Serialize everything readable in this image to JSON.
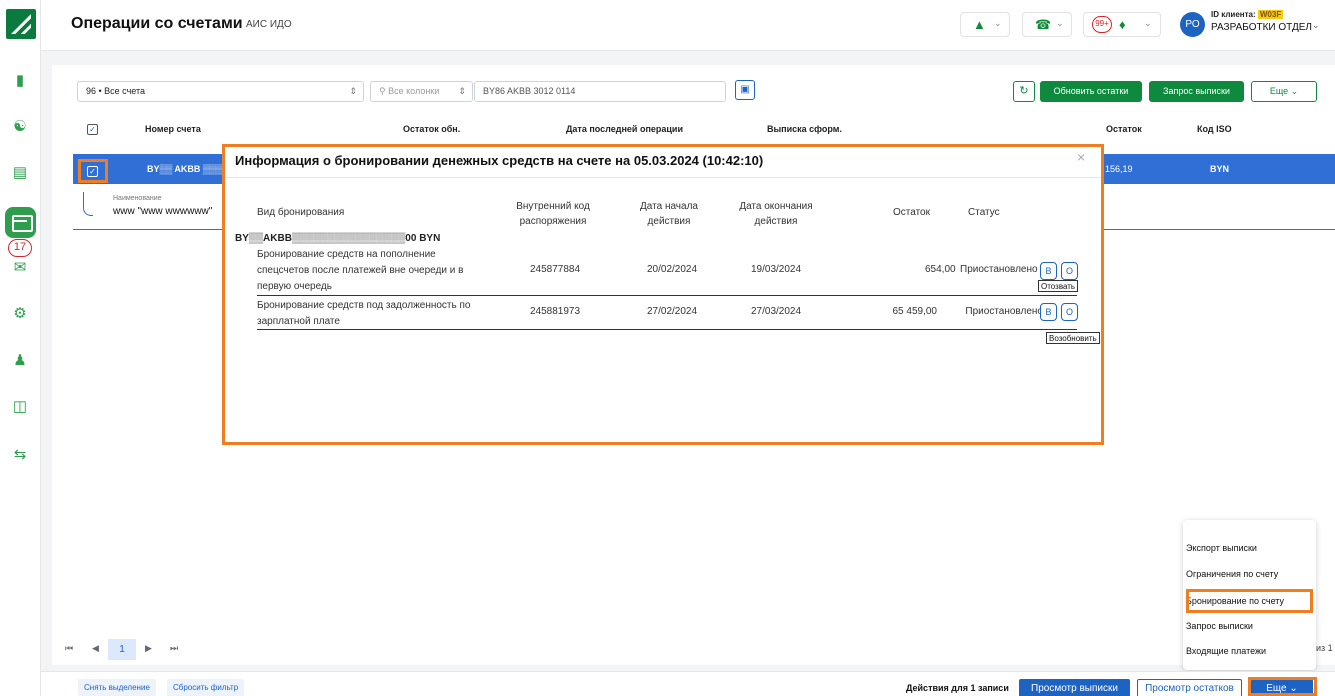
{
  "header": {
    "title": "Операции со счетами",
    "subtitle": "АИС ИДО",
    "notifications_count": "99+",
    "avatar_initials": "РО",
    "client_id_label": "ID клиента:",
    "client_id_value": "W03F",
    "client_name": "РАЗРАБОТКИ ОТДЕЛ"
  },
  "sidebar": {
    "badge_count": "17"
  },
  "toolbar": {
    "account_select": "96 • Все счета",
    "column_select_placeholder": "Все колонки",
    "search_value": "BY86 AKBB 3012 0114",
    "refresh_balances_label": "Обновить остатки",
    "request_statement_label": "Запрос выписки",
    "more_label": "Еще"
  },
  "table": {
    "headers": [
      "Номер счета",
      "Остаток обн.",
      "Дата последней операции",
      "Выписка сформ.",
      "Остаток",
      "Код ISO"
    ],
    "selected_row": {
      "account": "BY▒▒ AKBB ▒▒▒",
      "balance": "156,19",
      "iso": "BYN"
    },
    "sub_row": {
      "label": "Наименование",
      "value": "www \"www wwwwww\""
    }
  },
  "modal": {
    "title": "Информация о бронировании денежных средств на счете на 05.03.2024 (10:42:10)",
    "close_label": "×",
    "columns": [
      "Вид бронирования",
      "Внутренний код распоряжения",
      "Дата начала действия",
      "Дата окончания действия",
      "Остаток",
      "Статус"
    ],
    "account_line": "BY▒▒AKBB▒▒▒▒▒▒▒▒▒▒▒▒▒▒▒▒00 BYN",
    "rows": [
      {
        "type": "Бронирование средств на пополнение спецсчетов после платежей вне очереди и в первую очередь",
        "code": "245877884",
        "start": "20/02/2024",
        "end": "19/03/2024",
        "balance": "654,00",
        "status": "Приостановлено",
        "btn_b": "В",
        "btn_o": "О"
      },
      {
        "type": "Бронирование средств под задолженность по зарплатной плате",
        "code": "245881973",
        "start": "27/02/2024",
        "end": "27/03/2024",
        "balance": "65 459,00",
        "status": "Приостановлено",
        "btn_b": "В",
        "btn_o": "О"
      }
    ],
    "tooltip_revoke": "Отозвать",
    "tooltip_resume": "Возобновить"
  },
  "more_menu": {
    "items": [
      "Экспорт выписки",
      "Ограничения по счету",
      "Бронирование по счету",
      "Запрос выписки",
      "Входящие платежи"
    ]
  },
  "pager": {
    "current_page": "1",
    "of_text": "из 1"
  },
  "footer": {
    "clear_selection": "Снять выделение",
    "reset_filter": "Сбросить фильтр",
    "actions_for": "Действия для 1 записи",
    "view_statement": "Просмотр выписки",
    "view_balances": "Просмотр остатков",
    "more": "Еще"
  },
  "colors": {
    "brand_green": "#0d8a3d",
    "selection_blue": "#2f6fd6",
    "highlight_orange": "#ef7d21",
    "alert_red": "#d8262b"
  }
}
